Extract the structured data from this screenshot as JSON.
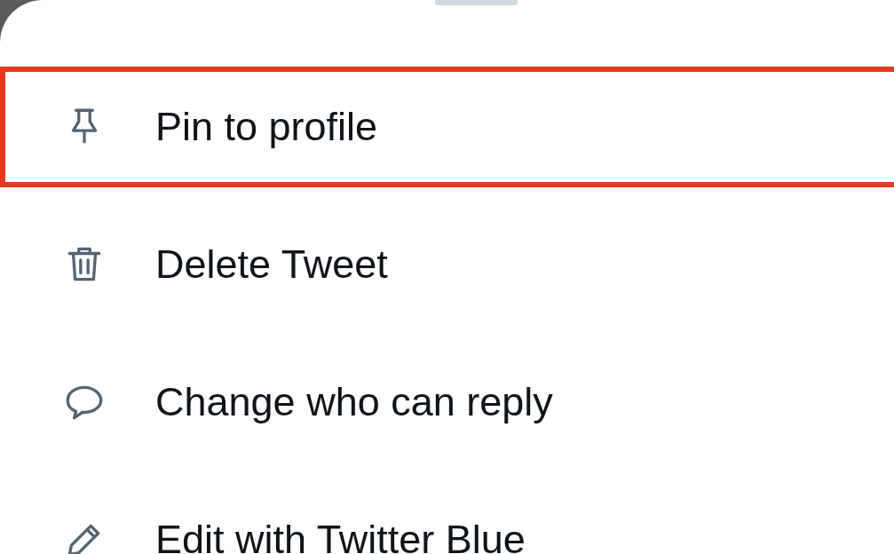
{
  "menu_items": [
    {
      "label": "Pin to profile",
      "kind": "pin",
      "highlighted": true
    },
    {
      "label": "Delete Tweet",
      "kind": "trash",
      "highlighted": false
    },
    {
      "label": "Change who can reply",
      "kind": "bubble",
      "highlighted": false
    },
    {
      "label": "Edit with Twitter Blue",
      "kind": "pencil",
      "highlighted": false
    }
  ]
}
